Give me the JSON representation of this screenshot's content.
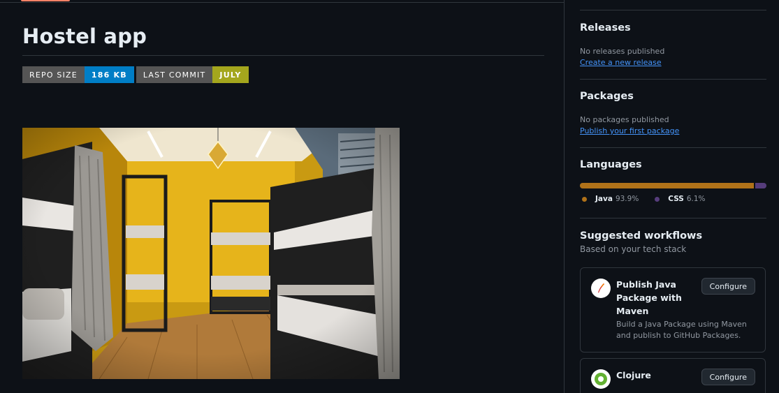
{
  "readme": {
    "title": "Hostel app",
    "badges": [
      {
        "label": "REPO SIZE",
        "value": "186 KB",
        "color": "#007ec6"
      },
      {
        "label": "LAST COMMIT",
        "value": "JULY",
        "color": "#a4a61d"
      }
    ],
    "image_alt": "hostel dormitory room with bunk beds"
  },
  "sidebar": {
    "releases": {
      "heading": "Releases",
      "empty_text": "No releases published",
      "link": "Create a new release"
    },
    "packages": {
      "heading": "Packages",
      "empty_text": "No packages published",
      "link": "Publish your first package"
    },
    "languages": {
      "heading": "Languages",
      "items": [
        {
          "name": "Java",
          "percent": "93.9%",
          "value": 93.9,
          "color": "#b07219"
        },
        {
          "name": "CSS",
          "percent": "6.1%",
          "value": 6.1,
          "color": "#563d7c"
        }
      ]
    },
    "workflows": {
      "heading": "Suggested workflows",
      "subheading": "Based on your tech stack",
      "cards": [
        {
          "title": "Publish Java Package with Maven",
          "description": "Build a Java Package using Maven and publish to GitHub Packages.",
          "button": "Configure",
          "icon": "maven-feather-icon"
        },
        {
          "title": "Clojure",
          "description": "",
          "button": "Configure",
          "icon": "clojure-logo-icon"
        }
      ]
    }
  }
}
